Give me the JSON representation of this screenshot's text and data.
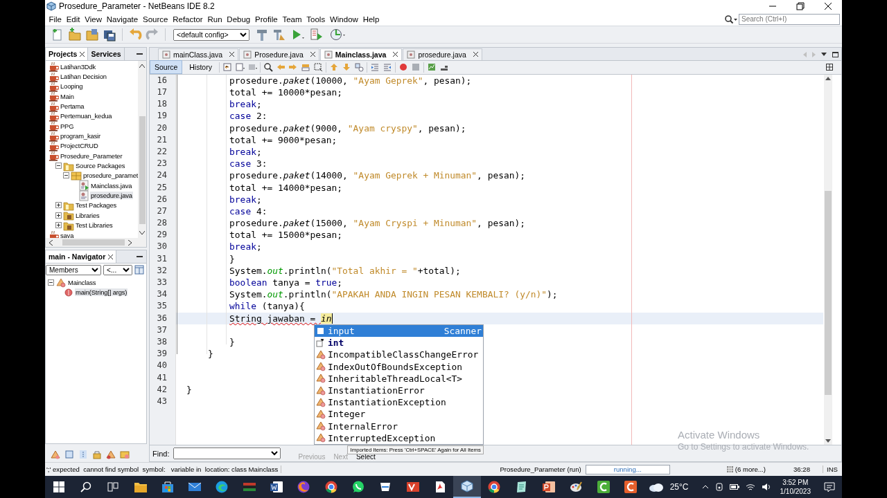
{
  "window": {
    "title": "Prosedure_Parameter - NetBeans IDE 8.2",
    "search_placeholder": "Search (Ctrl+I)"
  },
  "menu": [
    "File",
    "Edit",
    "View",
    "Navigate",
    "Source",
    "Refactor",
    "Run",
    "Debug",
    "Profile",
    "Team",
    "Tools",
    "Window",
    "Help"
  ],
  "toolbar": {
    "config": "<default config>"
  },
  "projects": {
    "tabs": [
      {
        "label": "Projects",
        "selected": true
      },
      {
        "label": "Services",
        "selected": false
      }
    ],
    "tree": [
      {
        "label": "Latihan3Ddk",
        "kind": "project",
        "selected": false
      },
      {
        "label": "Latihan Decision",
        "kind": "project",
        "selected": false
      },
      {
        "label": "Looping",
        "kind": "project",
        "selected": false
      },
      {
        "label": "Main",
        "kind": "project",
        "selected": false
      },
      {
        "label": "Pertama",
        "kind": "project",
        "selected": false
      },
      {
        "label": "Pertemuan_kedua",
        "kind": "project",
        "selected": false
      },
      {
        "label": "PPG",
        "kind": "project",
        "selected": false
      },
      {
        "label": "program_kasir",
        "kind": "project",
        "selected": false
      },
      {
        "label": "ProjectCRUD",
        "kind": "project",
        "selected": false
      },
      {
        "label": "Prosedure_Parameter",
        "kind": "project",
        "selected": false,
        "children": [
          {
            "label": "Source Packages",
            "kind": "folder",
            "expanded": true,
            "selected": false,
            "children": [
              {
                "label": "prosedure_paramet",
                "kind": "package",
                "expanded": true,
                "selected": false,
                "children": [
                  {
                    "label": "Mainclass.java",
                    "kind": "main-class",
                    "selected": false
                  },
                  {
                    "label": "prosedure.java",
                    "kind": "java",
                    "selected": true
                  }
                ]
              }
            ]
          },
          {
            "label": "Test Packages",
            "kind": "folder",
            "expanded": false,
            "selected": false
          },
          {
            "label": "Libraries",
            "kind": "library",
            "expanded": false,
            "selected": false
          },
          {
            "label": "Test Libraries",
            "kind": "library",
            "expanded": false,
            "selected": false
          }
        ]
      },
      {
        "label": "saya",
        "kind": "project",
        "selected": false
      }
    ]
  },
  "navigator": {
    "title": "main - Navigator",
    "filter": "Members",
    "filter_2": "<...",
    "tree": [
      {
        "label": "Mainclass",
        "kind": "class",
        "expanded": true,
        "selected": false,
        "children": [
          {
            "label": "main(String[] args)",
            "kind": "method",
            "selected": true
          }
        ]
      }
    ]
  },
  "editor": {
    "tabs": [
      {
        "label": "mainClass.java",
        "selected": false
      },
      {
        "label": "Prosedure.java",
        "selected": false
      },
      {
        "label": "Mainclass.java",
        "selected": true
      },
      {
        "label": "prosedure.java",
        "selected": false
      }
    ],
    "views": [
      {
        "label": "Source",
        "selected": true
      },
      {
        "label": "History",
        "selected": false
      }
    ],
    "lines": [
      {
        "number": "16",
        "current": false,
        "segments": [
          {
            "text": "        prosedure.",
            "kind": "plain"
          },
          {
            "text": "paket",
            "kind": "method"
          },
          {
            "text": "(10000, ",
            "kind": "plain"
          },
          {
            "text": "\"Ayam Geprek\"",
            "kind": "string"
          },
          {
            "text": ", pesan);",
            "kind": "plain"
          }
        ]
      },
      {
        "number": "17",
        "current": false,
        "segments": [
          {
            "text": "        total += 10000*pesan;",
            "kind": "plain"
          }
        ]
      },
      {
        "number": "18",
        "current": false,
        "segments": [
          {
            "text": "        break",
            "kind": "keyword"
          },
          {
            "text": ";",
            "kind": "plain"
          }
        ]
      },
      {
        "number": "19",
        "current": false,
        "segments": [
          {
            "text": "        case",
            "kind": "keyword"
          },
          {
            "text": " 2:",
            "kind": "plain"
          }
        ]
      },
      {
        "number": "20",
        "current": false,
        "segments": [
          {
            "text": "        prosedure.",
            "kind": "plain"
          },
          {
            "text": "paket",
            "kind": "method"
          },
          {
            "text": "(9000, ",
            "kind": "plain"
          },
          {
            "text": "\"Ayam cryspy\"",
            "kind": "string"
          },
          {
            "text": ", pesan);",
            "kind": "plain"
          }
        ]
      },
      {
        "number": "21",
        "current": false,
        "segments": [
          {
            "text": "        total += 9000*pesan;",
            "kind": "plain"
          }
        ]
      },
      {
        "number": "22",
        "current": false,
        "segments": [
          {
            "text": "        break",
            "kind": "keyword"
          },
          {
            "text": ";",
            "kind": "plain"
          }
        ]
      },
      {
        "number": "23",
        "current": false,
        "segments": [
          {
            "text": "        case",
            "kind": "keyword"
          },
          {
            "text": " 3:",
            "kind": "plain"
          }
        ]
      },
      {
        "number": "24",
        "current": false,
        "segments": [
          {
            "text": "        prosedure.",
            "kind": "plain"
          },
          {
            "text": "paket",
            "kind": "method"
          },
          {
            "text": "(14000, ",
            "kind": "plain"
          },
          {
            "text": "\"Ayam Geprek + Minuman\"",
            "kind": "string"
          },
          {
            "text": ", pesan);",
            "kind": "plain"
          }
        ]
      },
      {
        "number": "25",
        "current": false,
        "segments": [
          {
            "text": "        total += 14000*pesan;",
            "kind": "plain"
          }
        ]
      },
      {
        "number": "26",
        "current": false,
        "segments": [
          {
            "text": "        break",
            "kind": "keyword"
          },
          {
            "text": ";",
            "kind": "plain"
          }
        ]
      },
      {
        "number": "27",
        "current": false,
        "segments": [
          {
            "text": "        case",
            "kind": "keyword"
          },
          {
            "text": " 4:",
            "kind": "plain"
          }
        ]
      },
      {
        "number": "28",
        "current": false,
        "segments": [
          {
            "text": "        prosedure.",
            "kind": "plain"
          },
          {
            "text": "paket",
            "kind": "method"
          },
          {
            "text": "(15000, ",
            "kind": "plain"
          },
          {
            "text": "\"Ayam Cryspi + Minuman\"",
            "kind": "string"
          },
          {
            "text": ", pesan);",
            "kind": "plain"
          }
        ]
      },
      {
        "number": "29",
        "current": false,
        "segments": [
          {
            "text": "        total += 15000*pesan;",
            "kind": "plain"
          }
        ]
      },
      {
        "number": "30",
        "current": false,
        "segments": [
          {
            "text": "        break",
            "kind": "keyword"
          },
          {
            "text": ";",
            "kind": "plain"
          }
        ]
      },
      {
        "number": "31",
        "current": false,
        "segments": [
          {
            "text": "        }",
            "kind": "plain"
          }
        ]
      },
      {
        "number": "32",
        "current": false,
        "segments": [
          {
            "text": "        System.",
            "kind": "plain"
          },
          {
            "text": "out",
            "kind": "field"
          },
          {
            "text": ".println(",
            "kind": "plain"
          },
          {
            "text": "\"Total akhir = \"",
            "kind": "string"
          },
          {
            "text": "+total);",
            "kind": "plain"
          }
        ]
      },
      {
        "number": "33",
        "current": false,
        "segments": [
          {
            "text": "        boolean",
            "kind": "keyword"
          },
          {
            "text": " tanya = ",
            "kind": "plain"
          },
          {
            "text": "true",
            "kind": "keyword"
          },
          {
            "text": ";",
            "kind": "plain"
          }
        ]
      },
      {
        "number": "34",
        "current": false,
        "segments": [
          {
            "text": "        System.",
            "kind": "plain"
          },
          {
            "text": "out",
            "kind": "field"
          },
          {
            "text": ".println(",
            "kind": "plain"
          },
          {
            "text": "\"APAKAH ANDA INGIN PESAN KEMBALI? (y/n)\"",
            "kind": "string"
          },
          {
            "text": ");",
            "kind": "plain"
          }
        ]
      },
      {
        "number": "35",
        "current": false,
        "segments": [
          {
            "text": "        while",
            "kind": "keyword"
          },
          {
            "text": " (tanya){",
            "kind": "plain"
          }
        ]
      },
      {
        "number": "36",
        "current": true,
        "segments": [
          {
            "text": "        String jawaban = ",
            "kind": "error"
          },
          {
            "text": "in",
            "kind": "typed"
          }
        ]
      },
      {
        "number": "37",
        "current": false
      },
      {
        "number": "38",
        "current": false,
        "segments": [
          {
            "text": "        }",
            "kind": "plain"
          }
        ]
      },
      {
        "number": "39",
        "current": false,
        "segments": [
          {
            "text": "    }",
            "kind": "plain"
          }
        ]
      },
      {
        "number": "40",
        "current": false
      },
      {
        "number": "41",
        "current": false
      },
      {
        "number": "42",
        "current": false,
        "segments": [
          {
            "text": "}",
            "kind": "plain"
          }
        ]
      },
      {
        "number": "43",
        "current": false
      }
    ]
  },
  "completion": {
    "items": [
      {
        "label": "input",
        "type": "Scanner",
        "kind": "variable",
        "selected": true
      },
      {
        "label": "int",
        "kind": "keyword",
        "selected": false
      },
      {
        "label": "IncompatibleClassChangeError",
        "kind": "class",
        "selected": false
      },
      {
        "label": "IndexOutOfBoundsException",
        "kind": "class",
        "selected": false
      },
      {
        "label": "InheritableThreadLocal<T>",
        "kind": "class",
        "selected": false
      },
      {
        "label": "InstantiationError",
        "kind": "class",
        "selected": false
      },
      {
        "label": "InstantiationException",
        "kind": "class",
        "selected": false
      },
      {
        "label": "Integer",
        "kind": "class",
        "selected": false
      },
      {
        "label": "InternalError",
        "kind": "class",
        "selected": false
      },
      {
        "label": "InterruptedException",
        "kind": "class",
        "selected": false
      }
    ],
    "hint": "Imported Items: Press 'Ctrl+SPACE' Again for All Items"
  },
  "find_bar": {
    "label": "Find:",
    "buttons": [
      {
        "label": "Previous",
        "disabled": true
      },
      {
        "label": "Next",
        "disabled": true
      },
      {
        "label": "Select",
        "disabled": false
      }
    ]
  },
  "activation": {
    "title": "Activate Windows",
    "text": "Go to Settings to activate Windows."
  },
  "status_bar": {
    "message": "';' expected  cannot find symbol  symbol:   variable in  location: class Mainclass",
    "task": "Prosedure_Parameter (run)",
    "progress": "running...",
    "more": "(6 more...)",
    "position": "36:28",
    "mode": "INS"
  },
  "taskbar": {
    "apps": [
      {
        "kind": "explorer",
        "active": false
      },
      {
        "kind": "store",
        "active": false
      },
      {
        "kind": "mail",
        "active": false
      },
      {
        "kind": "edge",
        "active": false
      },
      {
        "kind": "flag",
        "active": false
      },
      {
        "kind": "word",
        "active": false
      },
      {
        "kind": "firefox",
        "active": false
      },
      {
        "kind": "chrome",
        "active": false
      },
      {
        "kind": "whatsapp",
        "active": false
      },
      {
        "kind": "scan",
        "active": false
      },
      {
        "kind": "vector",
        "active": false
      },
      {
        "kind": "pdf",
        "active": false
      },
      {
        "kind": "cube",
        "active": true
      },
      {
        "kind": "chrome",
        "active": false
      },
      {
        "kind": "notes",
        "active": false
      },
      {
        "kind": "powerpoint",
        "active": false
      },
      {
        "kind": "paint",
        "active": false
      },
      {
        "kind": "camtasia-green",
        "active": false
      },
      {
        "kind": "camtasia-orange",
        "active": false
      }
    ],
    "temperature": "25°C",
    "time": "3:52 PM",
    "date": "1/10/2023"
  }
}
